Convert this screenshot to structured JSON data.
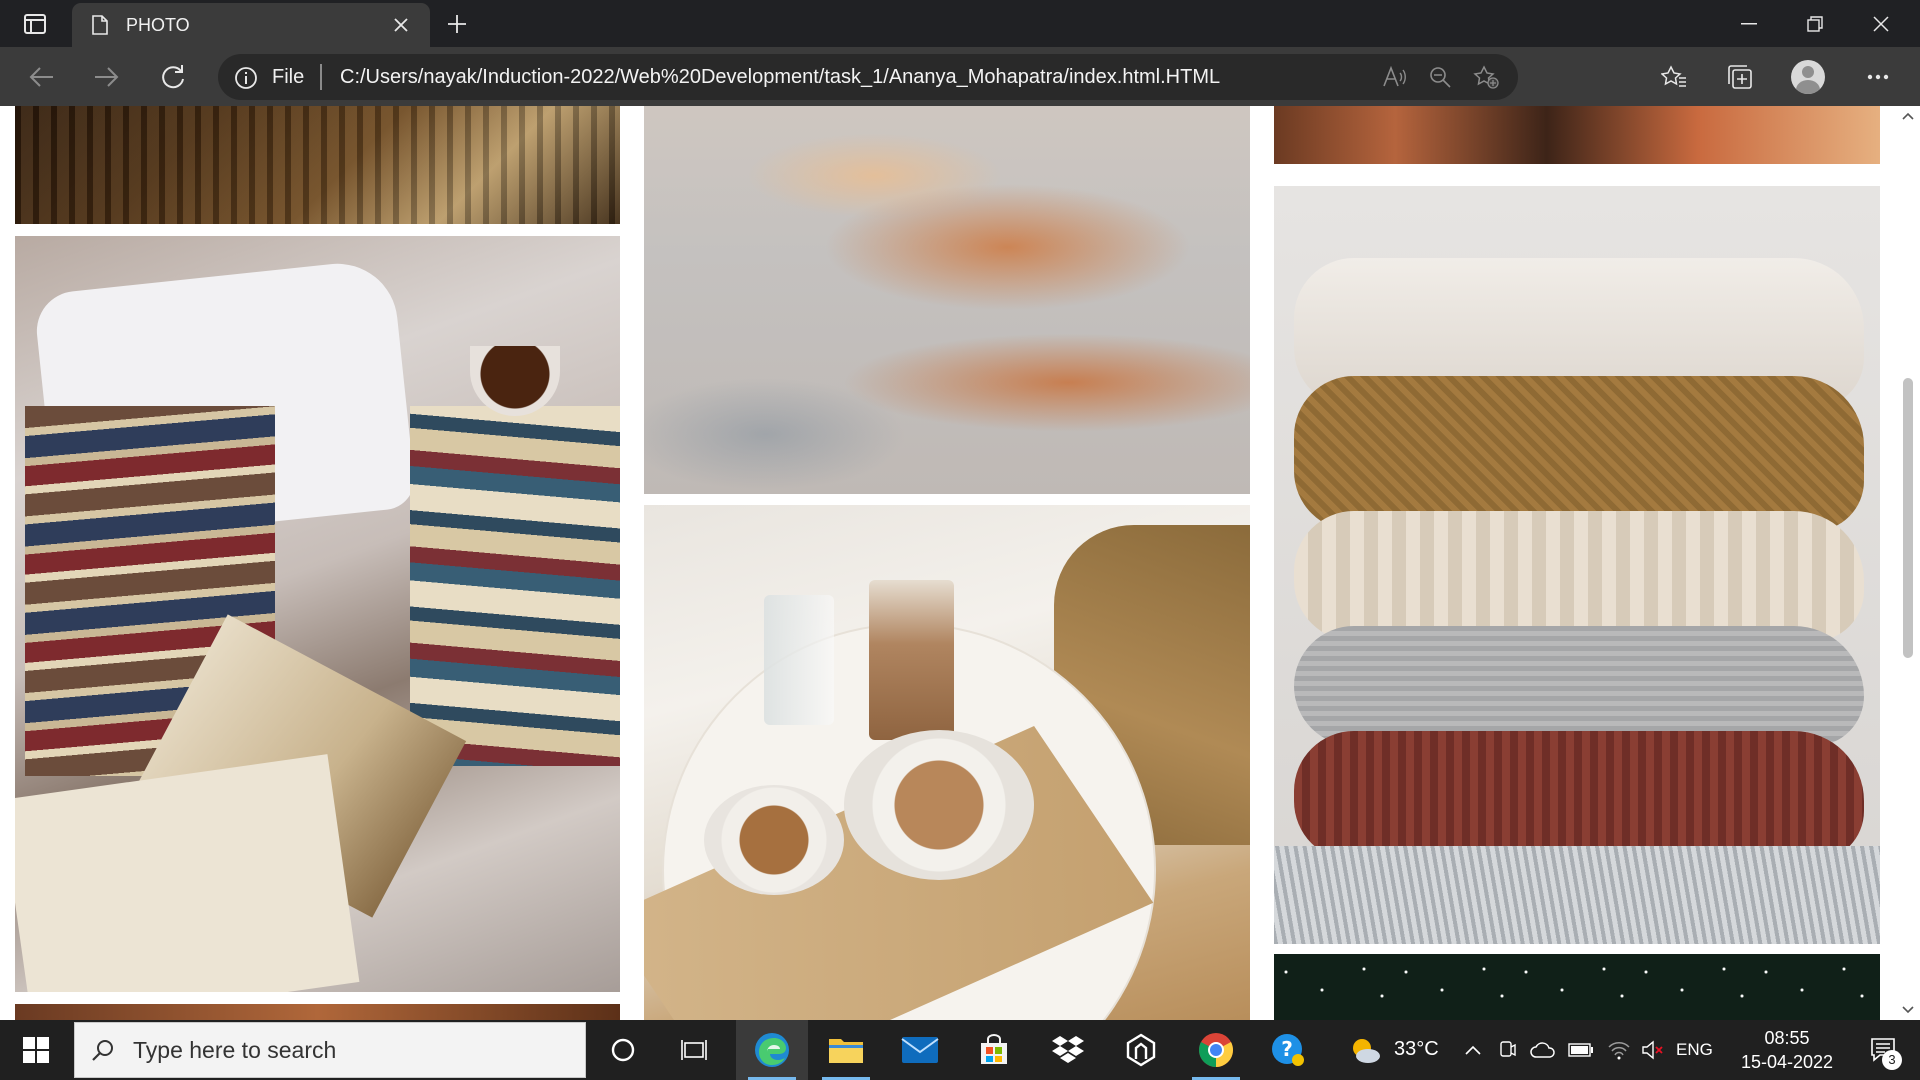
{
  "browser": {
    "tab": {
      "title": "PHOTO"
    },
    "address": {
      "scheme_label": "File",
      "url": "C:/Users/nayak/Induction-2022/Web%20Development/task_1/Ananya_Mohapatra/index.html.HTML"
    }
  },
  "page": {
    "photos": [
      {
        "subject": "bookshelf"
      },
      {
        "subject": "books on bed with tea"
      },
      {
        "subject": "cloudy sky"
      },
      {
        "subject": "coffee on cafe table"
      },
      {
        "subject": "potted plants"
      },
      {
        "subject": "folded knit sweaters"
      },
      {
        "subject": "starry night"
      }
    ]
  },
  "taskbar": {
    "search_placeholder": "Type here to search",
    "weather": "33°C",
    "language": "ENG",
    "time": "08:55",
    "date": "15-04-2022",
    "notifications_count": "3"
  },
  "colors": {
    "tabbar_bg": "#202124",
    "toolbar_bg": "#3b3b3b",
    "taskbar_bg": "#202020",
    "edge_blue": "#1f8ad2"
  }
}
